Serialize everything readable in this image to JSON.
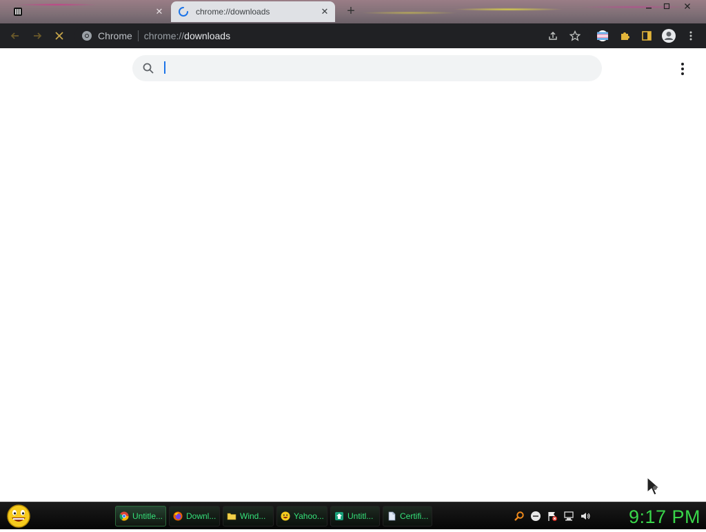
{
  "browser": {
    "tabs": [
      {
        "title": "",
        "active": false
      },
      {
        "title": "chrome://downloads",
        "active": true
      }
    ],
    "new_tab_label": "+",
    "omnibox": {
      "site_label": "Chrome",
      "url_scheme": "chrome://",
      "url_host": "downloads"
    }
  },
  "downloads_page": {
    "search": {
      "value": "",
      "placeholder": ""
    }
  },
  "taskbar": {
    "items": [
      {
        "label": "Untitle...",
        "icon": "chrome-icon",
        "active": true
      },
      {
        "label": "Downl...",
        "icon": "firefox-icon",
        "active": false
      },
      {
        "label": "Wind...",
        "icon": "folder-icon",
        "active": false
      },
      {
        "label": "Yahoo...",
        "icon": "yahoo-messenger-icon",
        "active": false
      },
      {
        "label": "Untitl...",
        "icon": "app-icon",
        "active": false
      },
      {
        "label": "Certifi...",
        "icon": "document-icon",
        "active": false
      }
    ],
    "clock": "9:17 PM"
  },
  "colors": {
    "toolbar_bg": "#202124",
    "search_bg": "#f1f3f4",
    "taskbar_text": "#35e27a",
    "clock": "#39d64a",
    "caret": "#1a73e8"
  }
}
